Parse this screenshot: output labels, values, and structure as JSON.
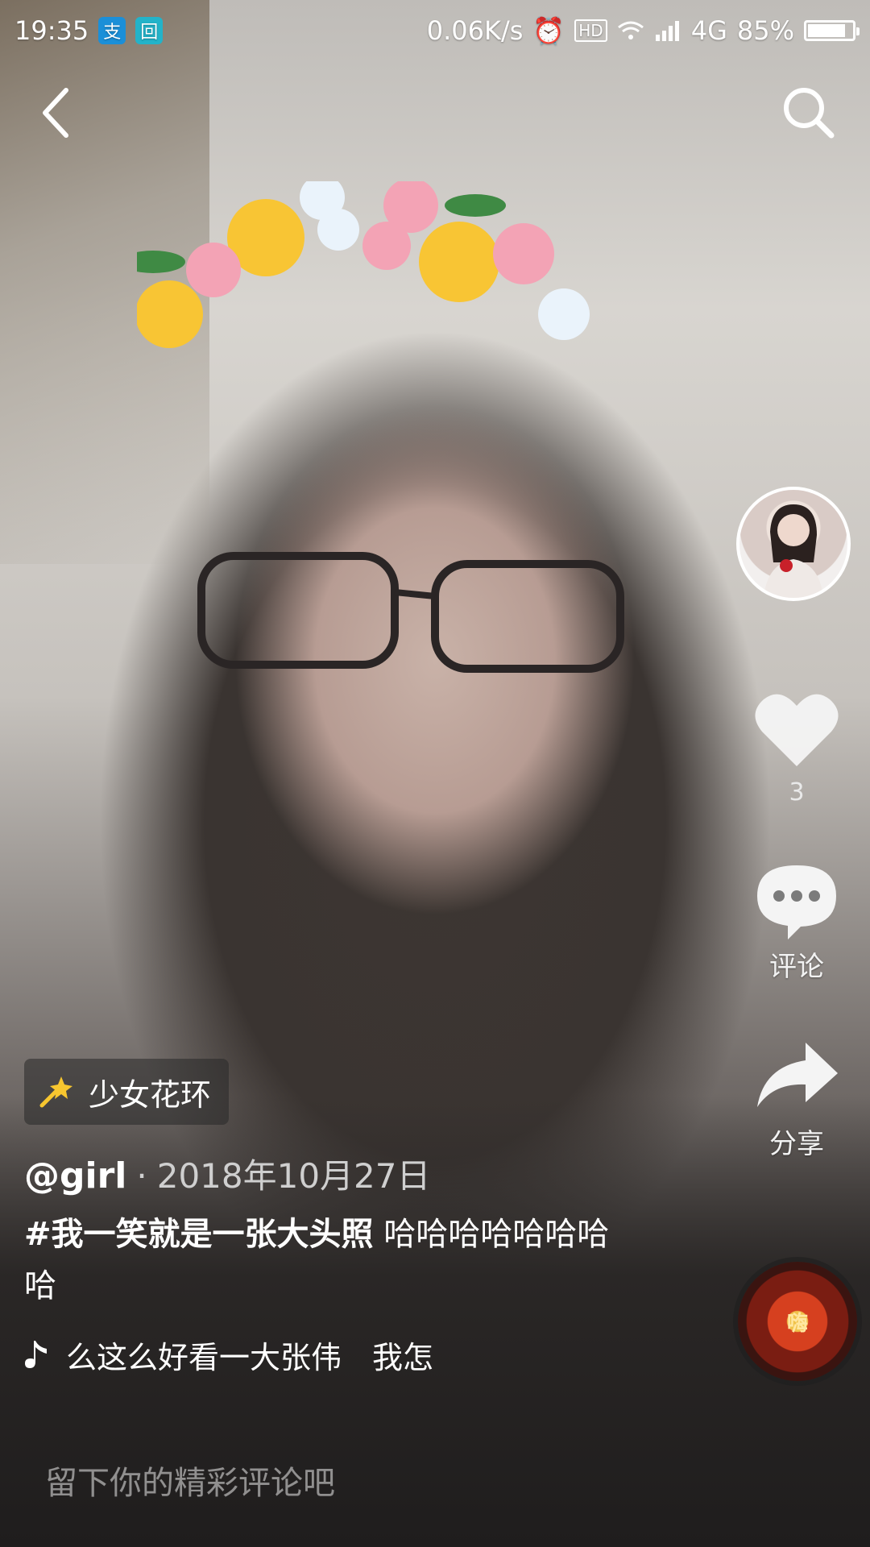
{
  "status_bar": {
    "time": "19:35",
    "network_speed": "0.06K/s",
    "signal": "4G",
    "battery_percent": "85%",
    "battery_level": 0.85,
    "app_icon_1": "支",
    "app_icon_2": "回"
  },
  "video": {
    "effect_tag": "少女花环",
    "author": "@girl",
    "dot": "·",
    "date": "2018年10月27日",
    "hashtag": "#我一笑就是一张大头照",
    "description": " 哈哈哈哈哈哈哈哈",
    "music_text": "么这么好看一大张伟　我怎"
  },
  "actions": {
    "like_count": "3",
    "comment_label": "评论",
    "share_label": "分享",
    "disc_text": "嗨"
  },
  "comment_input": {
    "placeholder": "留下你的精彩评论吧"
  },
  "icons": {
    "back": "back-arrow-icon",
    "search": "search-icon",
    "like": "heart-icon",
    "comment": "comment-bubble-icon",
    "share": "share-arrow-icon",
    "effect": "sparkle-wand-icon",
    "music": "music-note-icon"
  },
  "colors": {
    "effect_icon": "#f7c62f",
    "accent": "#ffffff"
  }
}
